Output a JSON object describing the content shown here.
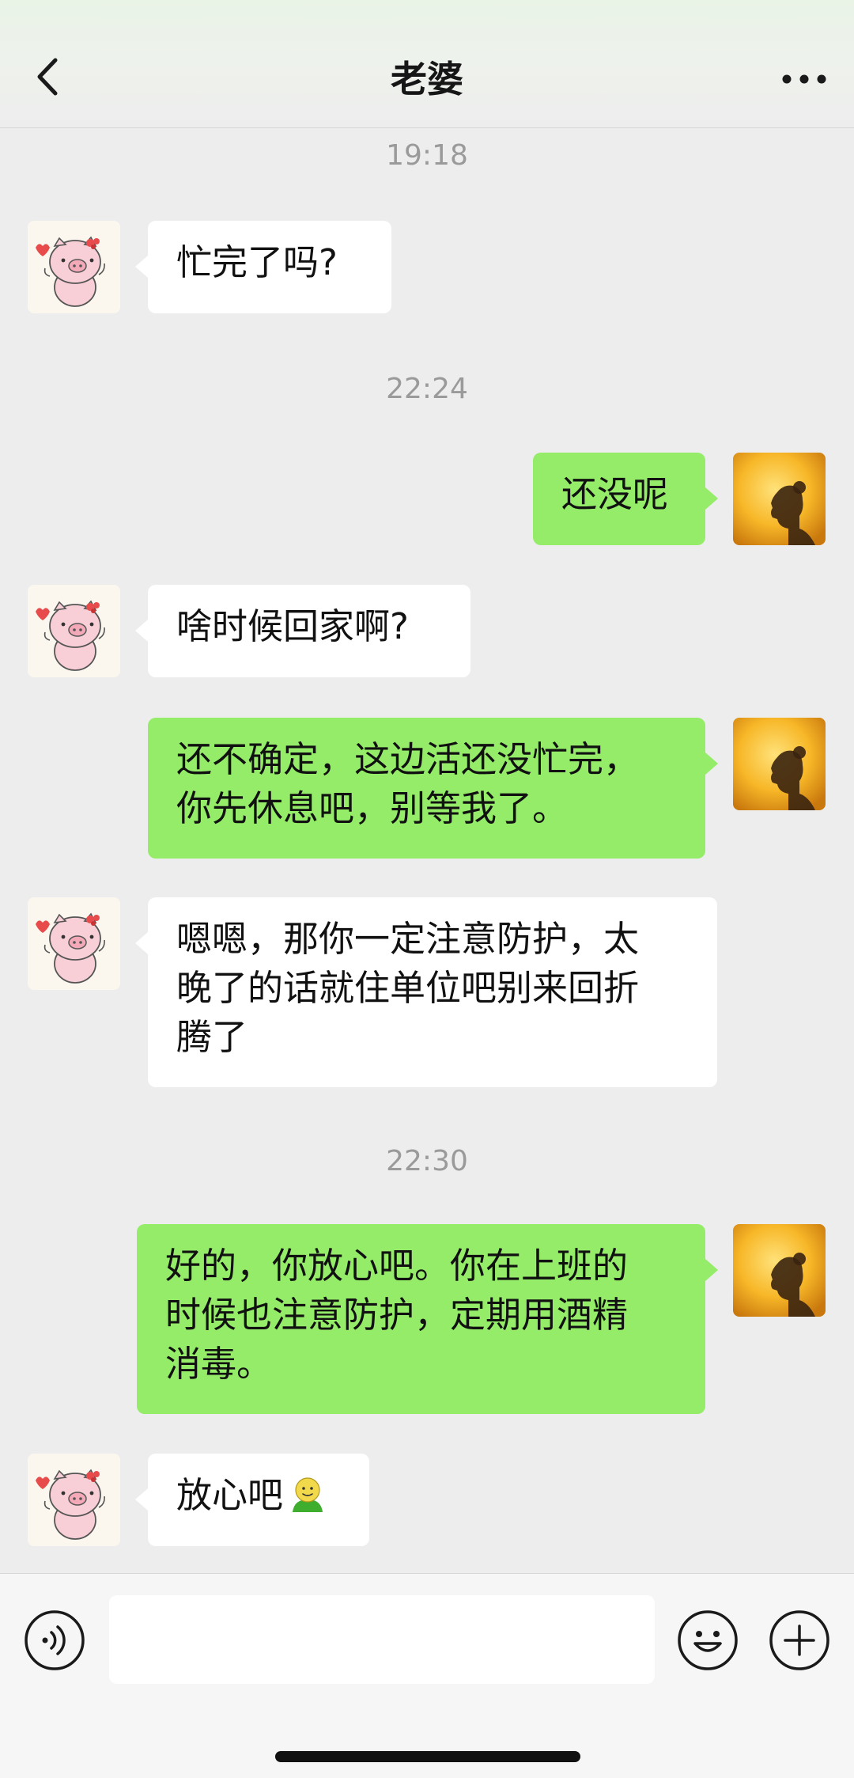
{
  "header": {
    "title": "老婆",
    "back_icon": "chevron-left-icon",
    "more_icon": "more-dots-icon"
  },
  "chat": {
    "timestamps": [
      "19:18",
      "22:24",
      "22:30"
    ],
    "messages": [
      {
        "from": "contact",
        "text": "忙完了吗?"
      },
      {
        "from": "me",
        "text": "还没呢"
      },
      {
        "from": "contact",
        "text": "啥时候回家啊?"
      },
      {
        "from": "me",
        "lines": [
          "还不确定，这边活还没忙完，",
          "你先休息吧，别等我了。"
        ]
      },
      {
        "from": "contact",
        "lines": [
          "嗯嗯，那你一定注意防护，太",
          "晚了的话就住单位吧别来回折",
          "腾了"
        ]
      },
      {
        "from": "me",
        "lines": [
          "好的，你放心吧。你在上班的",
          "时候也注意防护，定期用酒精",
          "消毒。"
        ]
      },
      {
        "from": "contact",
        "text": "放心吧",
        "emoji": "smiling-face-emoji-icon"
      }
    ]
  },
  "input_bar": {
    "value": "",
    "placeholder": "",
    "voice_icon": "voice-icon",
    "emoji_icon": "emoji-icon",
    "plus_icon": "plus-icon"
  },
  "colors": {
    "background": "#ededed",
    "bubble_me": "#95ec69",
    "bubble_contact": "#ffffff",
    "timestamp_text": "#9a9a9a"
  }
}
